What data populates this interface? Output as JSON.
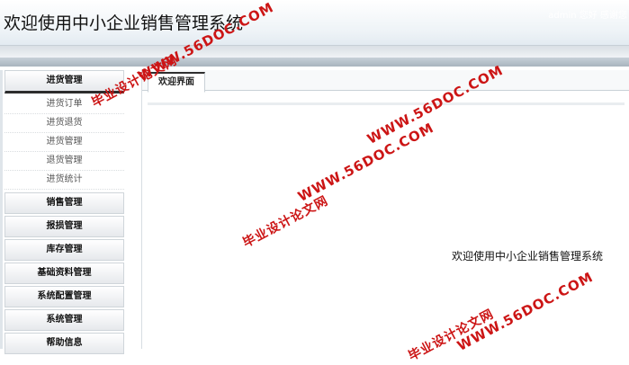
{
  "header": {
    "title": "欢迎使用中小企业销售管理系统",
    "user": "admin 您好 感谢您"
  },
  "sidebar": {
    "groups": [
      {
        "label": "进货管理",
        "items": [
          "进货订单",
          "进货退货",
          "进货管理",
          "退货管理",
          "进货统计"
        ]
      },
      {
        "label": "销售管理"
      },
      {
        "label": "报损管理"
      },
      {
        "label": "库存管理"
      },
      {
        "label": "基础资料管理"
      },
      {
        "label": "系统配置管理"
      },
      {
        "label": "系统管理"
      },
      {
        "label": "帮助信息"
      }
    ]
  },
  "main": {
    "tab_label": "欢迎界面",
    "welcome_text": "欢迎使用中小企业销售管理系统"
  },
  "watermarks": [
    "WWW.56DOC.COM",
    "毕业设计论文网",
    "WWW.56DOC.COM",
    "毕业设计论文网",
    "WWW.56DOC.COM",
    "毕业设计论文网",
    "WWW.56DOC.COM"
  ],
  "colors": {
    "watermark": "#cc1515",
    "header_bg": "#eef3f7",
    "active_indicator": "#2d2d2d"
  }
}
